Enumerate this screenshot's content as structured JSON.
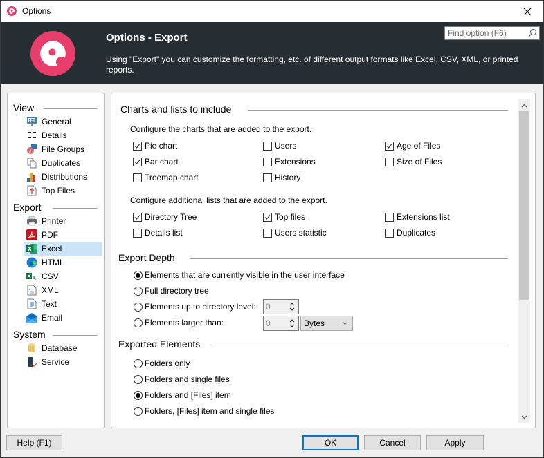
{
  "window": {
    "title": "Options",
    "app_icon": "app-logo-icon",
    "close_icon": "close-icon"
  },
  "header": {
    "title": "Options - Export",
    "description": "Using \"Export\" you can customize the formatting, etc. of different output formats like Excel, CSV, XML, or printed reports.",
    "search_placeholder": "Find option (F6)",
    "search_value": "",
    "brand_color": "#e83e6c",
    "background_color": "#272e33"
  },
  "nav": {
    "groups": [
      {
        "title": "View",
        "items": [
          {
            "label": "General",
            "icon": "monitor-icon"
          },
          {
            "label": "Details",
            "icon": "details-list-icon"
          },
          {
            "label": "File Groups",
            "icon": "file-groups-icon"
          },
          {
            "label": "Duplicates",
            "icon": "duplicates-icon"
          },
          {
            "label": "Distributions",
            "icon": "bar-chart-icon"
          },
          {
            "label": "Top Files",
            "icon": "top-files-icon"
          }
        ]
      },
      {
        "title": "Export",
        "items": [
          {
            "label": "Printer",
            "icon": "printer-icon"
          },
          {
            "label": "PDF",
            "icon": "pdf-icon"
          },
          {
            "label": "Excel",
            "icon": "excel-icon",
            "selected": true
          },
          {
            "label": "HTML",
            "icon": "html-icon"
          },
          {
            "label": "CSV",
            "icon": "csv-icon"
          },
          {
            "label": "XML",
            "icon": "xml-icon"
          },
          {
            "label": "Text",
            "icon": "text-icon"
          },
          {
            "label": "Email",
            "icon": "email-icon"
          }
        ]
      },
      {
        "title": "System",
        "items": [
          {
            "label": "Database",
            "icon": "database-icon"
          },
          {
            "label": "Service",
            "icon": "service-icon"
          }
        ]
      }
    ],
    "selected_color": "#cce4f7"
  },
  "content": {
    "charts_section": {
      "title": "Charts and lists to include",
      "charts_label": "Configure the charts that are added to the export.",
      "charts": [
        {
          "label": "Pie chart",
          "checked": true
        },
        {
          "label": "Users",
          "checked": false
        },
        {
          "label": "Age of Files",
          "checked": true
        },
        {
          "label": "Bar chart",
          "checked": true
        },
        {
          "label": "Extensions",
          "checked": false
        },
        {
          "label": "Size of Files",
          "checked": false
        },
        {
          "label": "Treemap chart",
          "checked": false
        },
        {
          "label": "History",
          "checked": false
        }
      ],
      "lists_label": "Configure additional lists that are added to the export.",
      "lists": [
        {
          "label": "Directory Tree",
          "checked": true
        },
        {
          "label": "Top files",
          "checked": true
        },
        {
          "label": "Extensions list",
          "checked": false
        },
        {
          "label": "Details list",
          "checked": false
        },
        {
          "label": "Users statistic",
          "checked": false
        },
        {
          "label": "Duplicates",
          "checked": false
        }
      ]
    },
    "depth_section": {
      "title": "Export Depth",
      "options": [
        {
          "label": "Elements that are currently visible in the user interface",
          "selected": true
        },
        {
          "label": "Full directory tree",
          "selected": false
        },
        {
          "label": "Elements up to directory level:",
          "selected": false
        },
        {
          "label": "Elements larger than:",
          "selected": false
        }
      ],
      "level_value": "0",
      "size_value": "0",
      "size_unit": "Bytes"
    },
    "elements_section": {
      "title": "Exported Elements",
      "options": [
        {
          "label": "Folders only",
          "selected": false
        },
        {
          "label": "Folders and single files",
          "selected": false
        },
        {
          "label": "Folders and [Files] item",
          "selected": true
        },
        {
          "label": "Folders, [Files] item and single files",
          "selected": false
        }
      ]
    }
  },
  "scrollbar": {
    "position": 0,
    "visible_fraction": 0.6
  },
  "buttons": {
    "help": "Help (F1)",
    "ok": "OK",
    "cancel": "Cancel",
    "apply": "Apply",
    "focus_color": "#0078d7"
  }
}
